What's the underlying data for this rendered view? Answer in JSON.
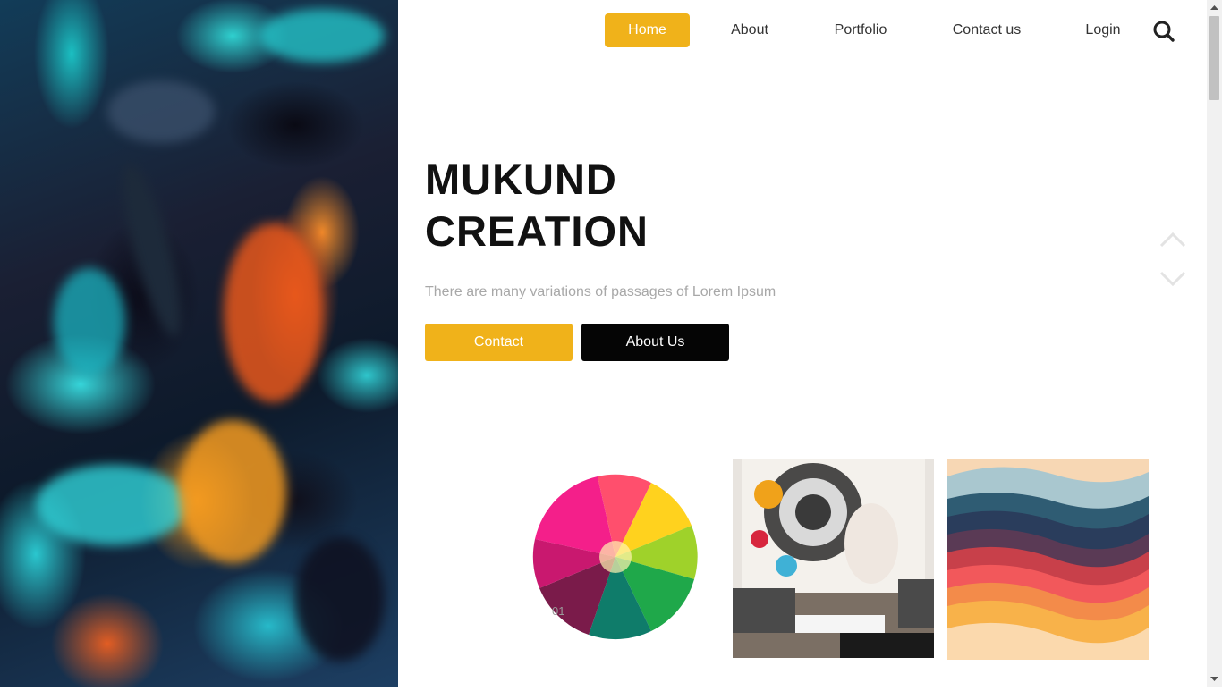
{
  "nav": {
    "items": [
      {
        "label": "Home",
        "active": true
      },
      {
        "label": "About",
        "active": false
      },
      {
        "label": "Portfolio",
        "active": false
      },
      {
        "label": "Contact us",
        "active": false
      },
      {
        "label": "Login",
        "active": false
      }
    ],
    "search_icon": "search-icon"
  },
  "hero": {
    "title_line1": "MUKUND",
    "title_line2": "CREATION",
    "subtitle": "There are many variations of passages of Lorem Ipsum",
    "contact_label": "Contact",
    "about_label": "About Us"
  },
  "slider": {
    "up_icon": "chevron-up-icon",
    "down_icon": "chevron-down-icon"
  },
  "gallery": {
    "first_index": "01"
  },
  "colors": {
    "accent": "#f0b21a",
    "dark_button": "#050505",
    "title": "#111111",
    "subtitle": "#a8a8a8"
  }
}
